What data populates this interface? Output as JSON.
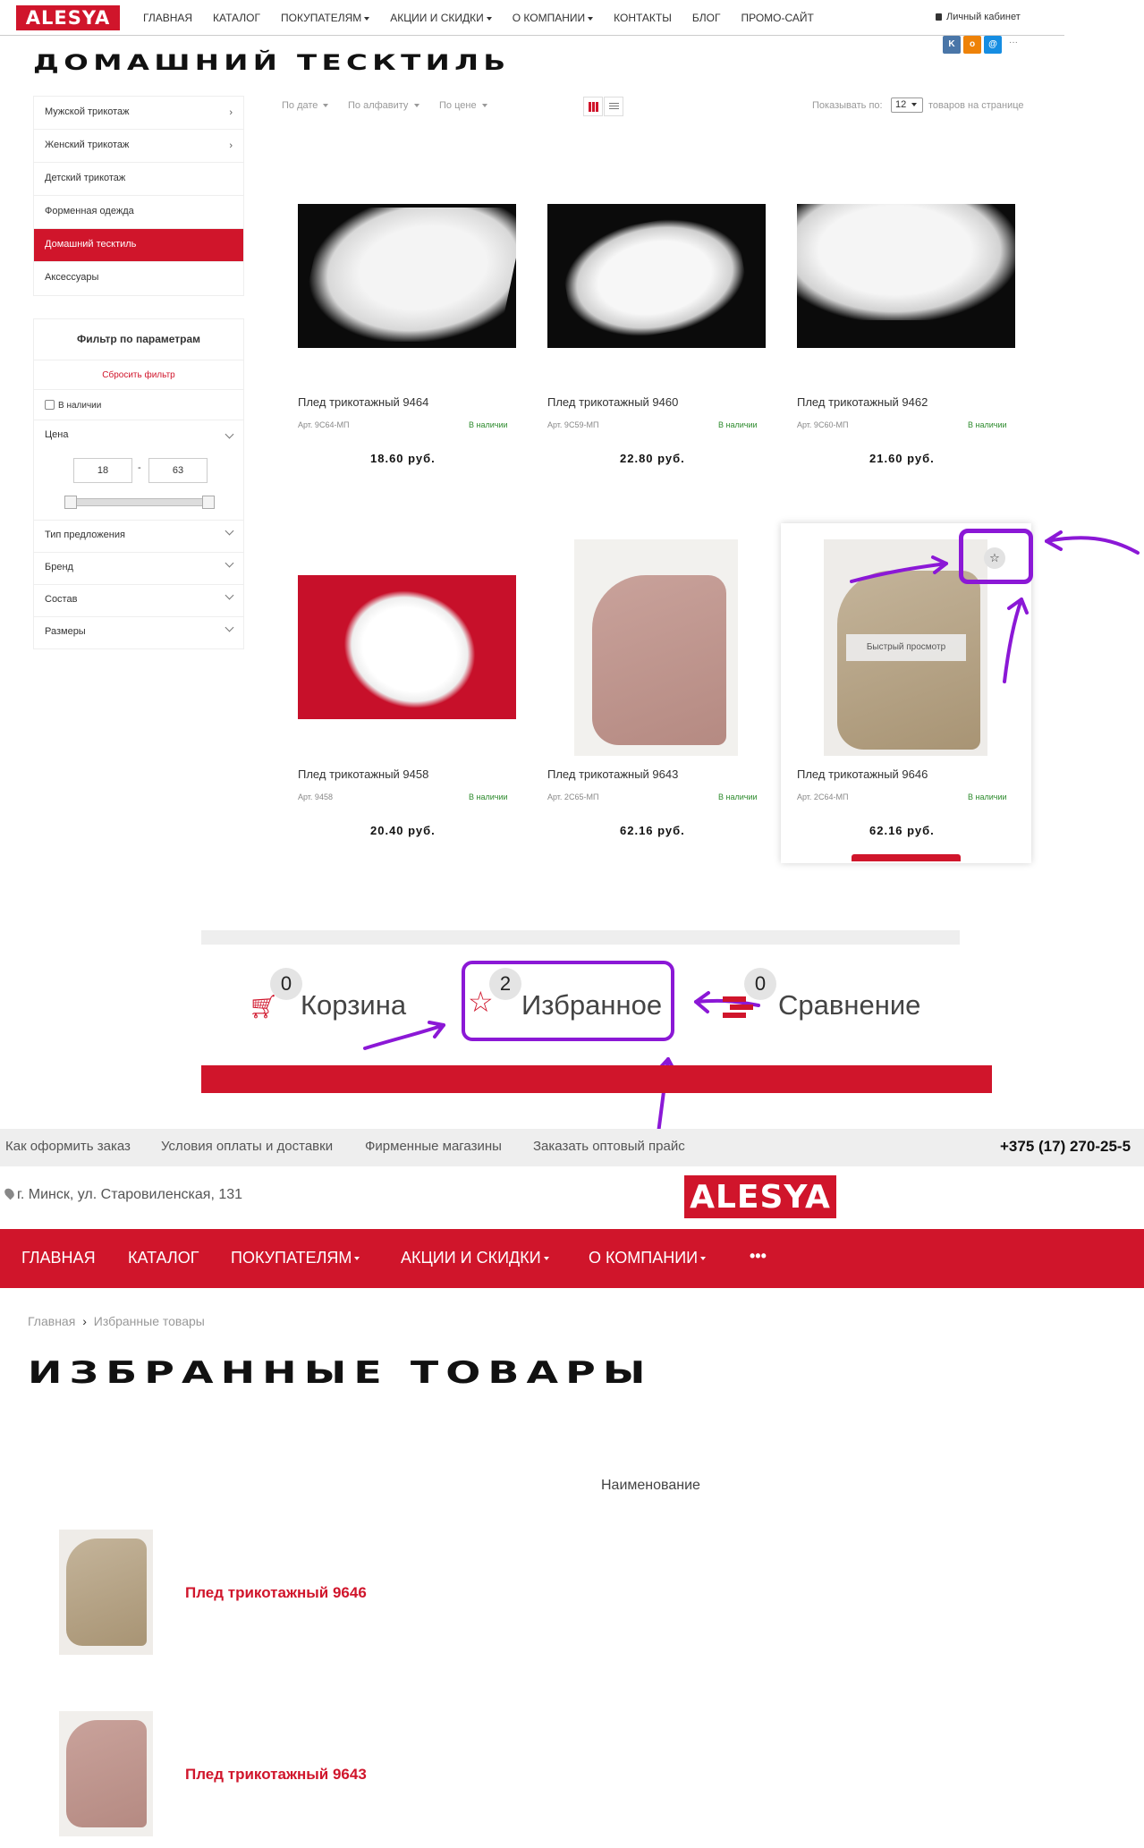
{
  "brand": {
    "logo_text": "ALESYA",
    "accent": "#d0152b",
    "annotation_color": "#8b18d6"
  },
  "top_nav": {
    "items": [
      "ГЛАВНАЯ",
      "КАТАЛОГ",
      "ПОКУПАТЕЛЯМ",
      "АКЦИИ И СКИДКИ",
      "О КОМПАНИИ",
      "КОНТАКТЫ",
      "БЛОГ",
      "ПРОМО-САЙТ"
    ],
    "account_label": "Личный кабинет"
  },
  "catalog_page": {
    "title": "ДОМАШНИЙ ТЕСКТИЛЬ",
    "social_icons": [
      "vk-icon",
      "ok-icon",
      "mail-icon",
      "more-icon"
    ],
    "categories": [
      {
        "label": "Мужской трикотаж",
        "has_children": true
      },
      {
        "label": "Женский трикотаж",
        "has_children": true
      },
      {
        "label": "Детский трикотаж",
        "has_children": false
      },
      {
        "label": "Форменная одежда",
        "has_children": false
      },
      {
        "label": "Домашний тесктиль",
        "has_children": false,
        "active": true
      },
      {
        "label": "Аксессуары",
        "has_children": false
      }
    ],
    "filter": {
      "title": "Фильтр по параметрам",
      "reset": "Сбросить фильтр",
      "in_stock": "В наличии",
      "price_label": "Цена",
      "price_min": "18",
      "price_sep": "-",
      "price_max": "63",
      "groups": [
        "Тип предложения",
        "Бренд",
        "Состав",
        "Размеры"
      ]
    },
    "sort": {
      "by_date": "По дате",
      "by_alpha": "По алфавиту",
      "by_price": "По цене"
    },
    "per_page": {
      "label": "Показывать по:",
      "value": "12",
      "suffix": "товаров на странице"
    },
    "quick_view": "Быстрый просмотр",
    "products": [
      {
        "title": "Плед трикотажный 9464",
        "art": "Арт. 9С64-МП",
        "stock": "В наличии",
        "price": "18.60 руб."
      },
      {
        "title": "Плед трикотажный 9460",
        "art": "Арт. 9С59-МП",
        "stock": "В наличии",
        "price": "22.80 руб."
      },
      {
        "title": "Плед трикотажный 9462",
        "art": "Арт. 9С60-МП",
        "stock": "В наличии",
        "price": "21.60 руб."
      },
      {
        "title": "Плед трикотажный 9458",
        "art": "Арт. 9458",
        "stock": "В наличии",
        "price": "20.40 руб."
      },
      {
        "title": "Плед трикотажный 9643",
        "art": "Арт. 2С65-МП",
        "stock": "В наличии",
        "price": "62.16 руб."
      },
      {
        "title": "Плед трикотажный 9646",
        "art": "Арт. 2С64-МП",
        "stock": "В наличии",
        "price": "62.16 руб."
      }
    ]
  },
  "header_counters": {
    "cart": {
      "label": "Корзина",
      "count": "0"
    },
    "favorites": {
      "label": "Избранное",
      "count": "2"
    },
    "compare": {
      "label": "Сравнение",
      "count": "0"
    }
  },
  "site_footer_bar": {
    "links": [
      "Как оформить заказ",
      "Условия оплаты и доставки",
      "Фирменные магазины",
      "Заказать оптовый прайс"
    ],
    "phone": "+375 (17) 270-25-5"
  },
  "address": "г. Минск, ул. Старовиленская, 131",
  "main_nav": {
    "items": [
      "ГЛАВНАЯ",
      "КАТАЛОГ",
      "ПОКУПАТЕЛЯМ",
      "АКЦИИ И СКИДКИ",
      "О КОМПАНИИ"
    ],
    "more": "•••"
  },
  "favorites_page": {
    "breadcrumb_home": "Главная",
    "breadcrumb_sep": "›",
    "breadcrumb_current": "Избранные товары",
    "title": "ИЗБРАННЫЕ ТОВАРЫ",
    "column_header": "Наименование",
    "items": [
      {
        "title": "Плед трикотажный 9646"
      },
      {
        "title": "Плед трикотажный 9643"
      }
    ]
  }
}
